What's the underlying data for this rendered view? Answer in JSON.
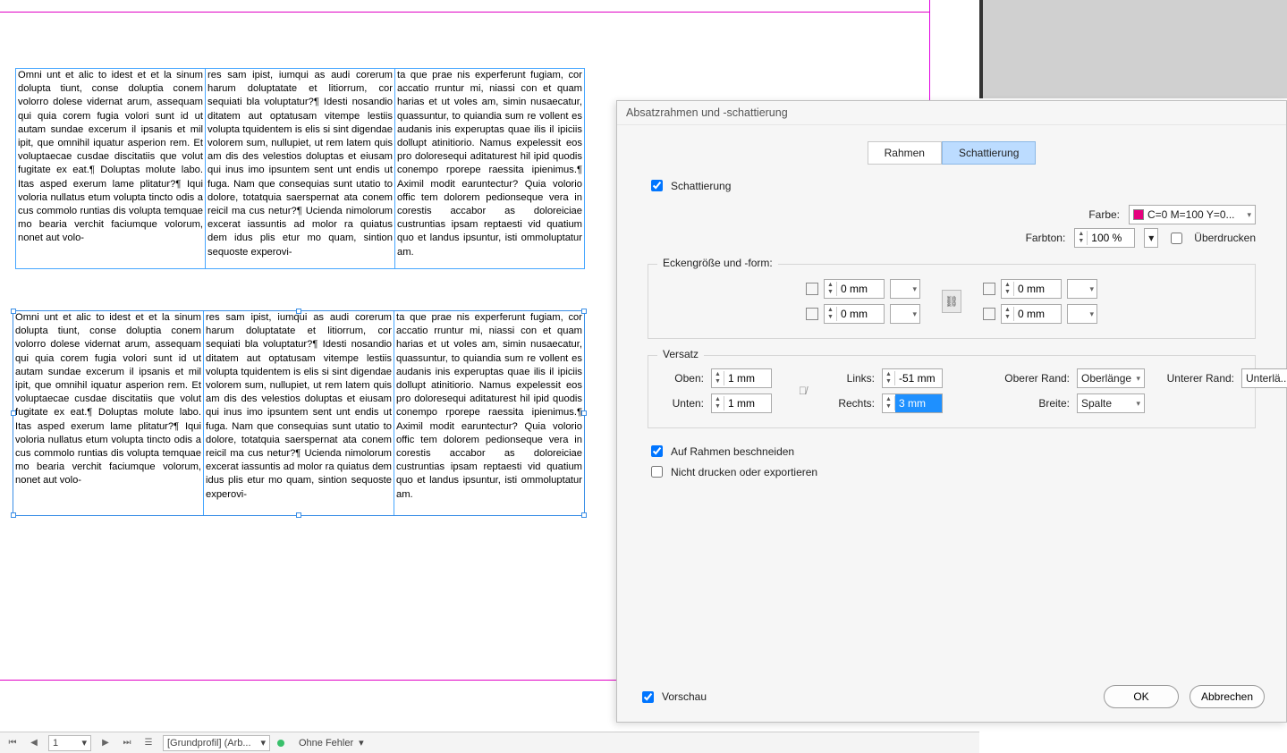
{
  "dialog": {
    "title": "Absatzrahmen und -schattierung",
    "tabs": {
      "frame": "Rahmen",
      "shading": "Schattierung"
    },
    "shading_check": "Schattierung",
    "color_label": "Farbe:",
    "color_value": "C=0 M=100 Y=0...",
    "tint_label": "Farbton:",
    "tint_value": "100 %",
    "overprint": "Überdrucken",
    "corners_title": "Eckengröße und -form:",
    "corner_value": "0 mm",
    "offset_title": "Versatz",
    "offset": {
      "top_label": "Oben:",
      "top": "1 mm",
      "bottom_label": "Unten:",
      "bottom": "1 mm",
      "left_label": "Links:",
      "left": "-51 mm",
      "right_label": "Rechts:",
      "right": "3 mm",
      "upper_label": "Oberer Rand:",
      "upper": "Oberlänge",
      "lower_label": "Unterer Rand:",
      "lower": "Unterlä...",
      "width_label": "Breite:",
      "width": "Spalte"
    },
    "clip": "Auf Rahmen beschneiden",
    "noprint": "Nicht drucken oder exportieren",
    "preview": "Vorschau",
    "ok": "OK",
    "cancel": "Abbrechen"
  },
  "statusbar": {
    "page": "1",
    "profile": "[Grundprofil] (Arb...",
    "errors": "Ohne Fehler"
  },
  "body": {
    "c1": "Omni unt et alic to idest et et la sinum dolupta tiunt, conse doluptia conem volorro dolese vidernat arum, assequam qui quia corem fugia volori sunt id ut autam sundae excerum il ipsanis et mil ipit, que omnihil iquatur asperion rem. Et voluptaecae cusdae discitatiis que volut fugitate ex eat.¶\nDoluptas molute labo. Itas asped exerum lame plitatur?¶\nIqui voloria nullatus etum volupta tincto odis a cus commolo runtias dis volupta temquae mo bearia verchit faciumque volorum, nonet aut volo-",
    "c2": "res sam ipist, iumqui as audi corerum harum doluptatate et litiorrum, cor sequiati bla voluptatur?¶\nIdesti nosandio ditatem aut optatusam vitempe lestiis volupta tquidentem is elis si sint digendae volorem sum, nullupiet, ut rem latem quis am dis des velestios doluptas et eiusam qui inus imo ipsuntem sent unt endis ut fuga. Nam que consequias sunt utatio to dolore, totatquia saerspernat ata conem reicil ma cus netur?¶\nUcienda nimolorum excerat iassuntis ad molor ra quiatus dem idus plis etur mo quam, sintion sequoste experovi-",
    "c3": "ta que prae nis experferunt fugiam, cor accatio rruntur mi, niassi con et quam harias et ut voles am, simin nusaecatur, quassuntur, to quiandia sum re vollent es audanis inis experuptas quae ilis il ipiciis dollupt atinitiorio. Namus expelessit eos pro doloresequi aditaturest hil ipid quodis conempo rporepe raessita ipienimus.¶\nAximil modit earuntectur? Quia volorio offic tem dolorem pedionseque vera in corestis accabor as doloreiciae custruntias ipsam reptaesti vid quatium quo et landus ipsuntur, isti ommoluptatur am."
  }
}
